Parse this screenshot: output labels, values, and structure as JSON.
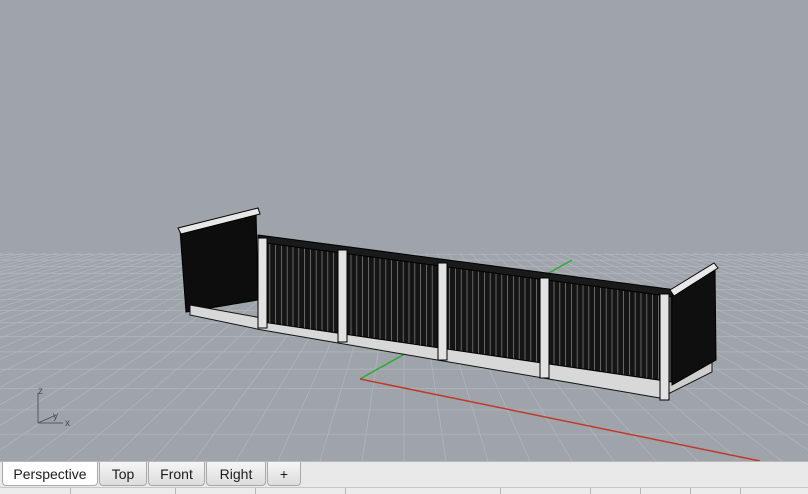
{
  "viewport": {
    "name": "Perspective",
    "background_color": "#9fa4ab",
    "grid_color": "#b3b7bd",
    "x_axis_color": "#c0392b",
    "y_axis_color": "#2eaa35",
    "model": "railing"
  },
  "axis_gizmo": {
    "z_label": "z",
    "y_label": "y",
    "x_label": "x"
  },
  "tabs": [
    {
      "label": "Perspective",
      "active": true
    },
    {
      "label": "Top",
      "active": false
    },
    {
      "label": "Front",
      "active": false
    },
    {
      "label": "Right",
      "active": false
    }
  ],
  "add_tab_label": "+"
}
